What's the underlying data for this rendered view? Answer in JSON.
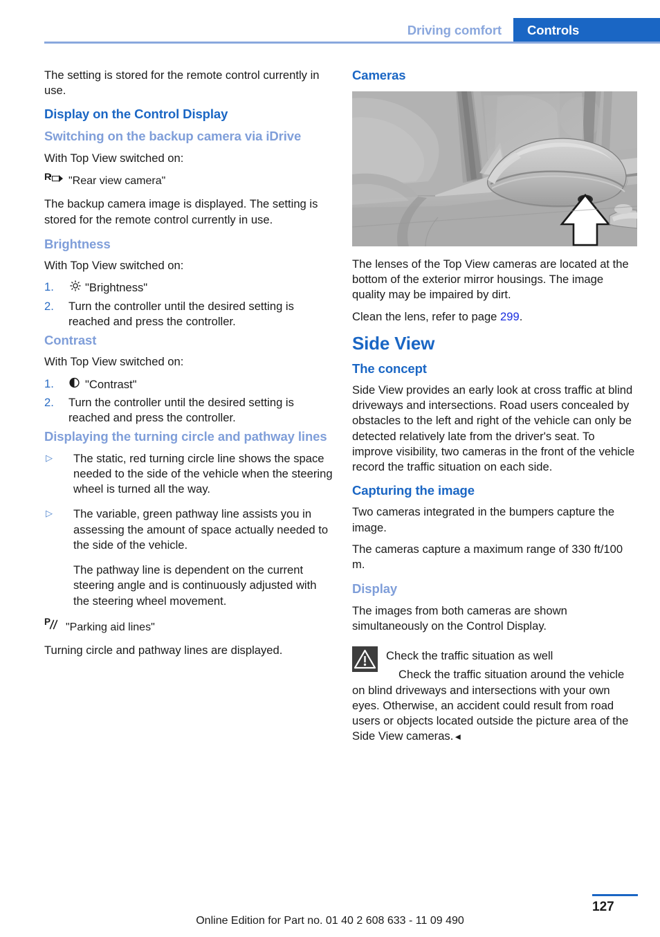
{
  "header": {
    "breadcrumb_inactive": "Driving comfort",
    "breadcrumb_active": "Controls"
  },
  "left_column": {
    "intro_paragraph": "The setting is stored for the remote control currently in use.",
    "heading_display_control": "Display on the Control Display",
    "heading_switching_backup": "Switching on the backup camera via iDrive",
    "switching_intro": "With Top View switched on:",
    "rear_view_camera_label": "\"Rear view camera\"",
    "rear_view_camera_icon": "rear-view-camera-icon",
    "backup_paragraph": "The backup camera image is displayed. The setting is stored for the remote control currently in use.",
    "heading_brightness": "Brightness",
    "brightness_intro": "With Top View switched on:",
    "brightness_steps": [
      {
        "num": "1.",
        "icon": "sun-icon",
        "text": "\"Brightness\""
      },
      {
        "num": "2.",
        "icon": "",
        "text": "Turn the controller until the desired setting is reached and press the controller."
      }
    ],
    "heading_contrast": "Contrast",
    "contrast_intro": "With Top View switched on:",
    "contrast_steps": [
      {
        "num": "1.",
        "icon": "contrast-icon",
        "text": "\"Contrast\""
      },
      {
        "num": "2.",
        "icon": "",
        "text": "Turn the controller until the desired setting is reached and press the controller."
      }
    ],
    "heading_turning_circle": "Displaying the turning circle and pathway lines",
    "turning_bullets": [
      {
        "marker": "▷",
        "text": "The static, red turning circle line shows the space needed to the side of the vehicle when the steering wheel is turned all the way."
      },
      {
        "marker": "▷",
        "text": "The variable, green pathway line assists you in assessing the amount of space actually needed to the side of the vehicle.",
        "sub_paragraph": "The pathway line is dependent on the current steering angle and is continuously adjusted with the steering wheel movement."
      }
    ],
    "parking_aid_label": "\"Parking aid lines\"",
    "parking_aid_icon": "parking-aid-lines-icon",
    "parking_aid_result": "Turning circle and pathway lines are displayed."
  },
  "right_column": {
    "heading_cameras": "Cameras",
    "illustration_alt": "Exterior mirror housing with arrow pointing to Top View camera lens at its bottom",
    "cameras_paragraph": "The lenses of the Top View cameras are located at the bottom of the exterior mirror housings. The image quality may be impaired by dirt.",
    "clean_lens_prefix": "Clean the lens, refer to page ",
    "clean_lens_page": "299",
    "clean_lens_suffix": ".",
    "heading_side_view": "Side View",
    "heading_the_concept": "The concept",
    "concept_paragraph": "Side View provides an early look at cross traffic at blind driveways and intersections. Road users concealed by obstacles to the left and right of the vehicle can only be detected relatively late from the driver's seat. To improve visibility, two cameras in the front of the vehicle record the traffic situation on each side.",
    "heading_capturing": "Capturing the image",
    "capturing_paragraph_1": "Two cameras integrated in the bumpers capture the image.",
    "capturing_paragraph_2": "The cameras capture a maximum range of 330 ft/100 m.",
    "heading_display": "Display",
    "display_paragraph": "The images from both cameras are shown simultaneously on the Control Display.",
    "warning_icon": "warning-triangle-icon",
    "warning_title": "Check the traffic situation as well",
    "warning_body": "Check the traffic situation around the vehicle on blind driveways and intersections with your own eyes. Otherwise, an accident could result from road users or objects located outside the picture area of the Side View cameras.",
    "warning_endmark": "◄"
  },
  "footer": {
    "edition_text": "Online Edition for Part no. 01 40 2 608 633 - 11 09 490",
    "page_number": "127"
  },
  "colors": {
    "accent_blue": "#1a66c4",
    "light_blue": "#7f9ed9",
    "link_blue": "#1a2ee0",
    "warning_box": "#3d3d3d"
  }
}
